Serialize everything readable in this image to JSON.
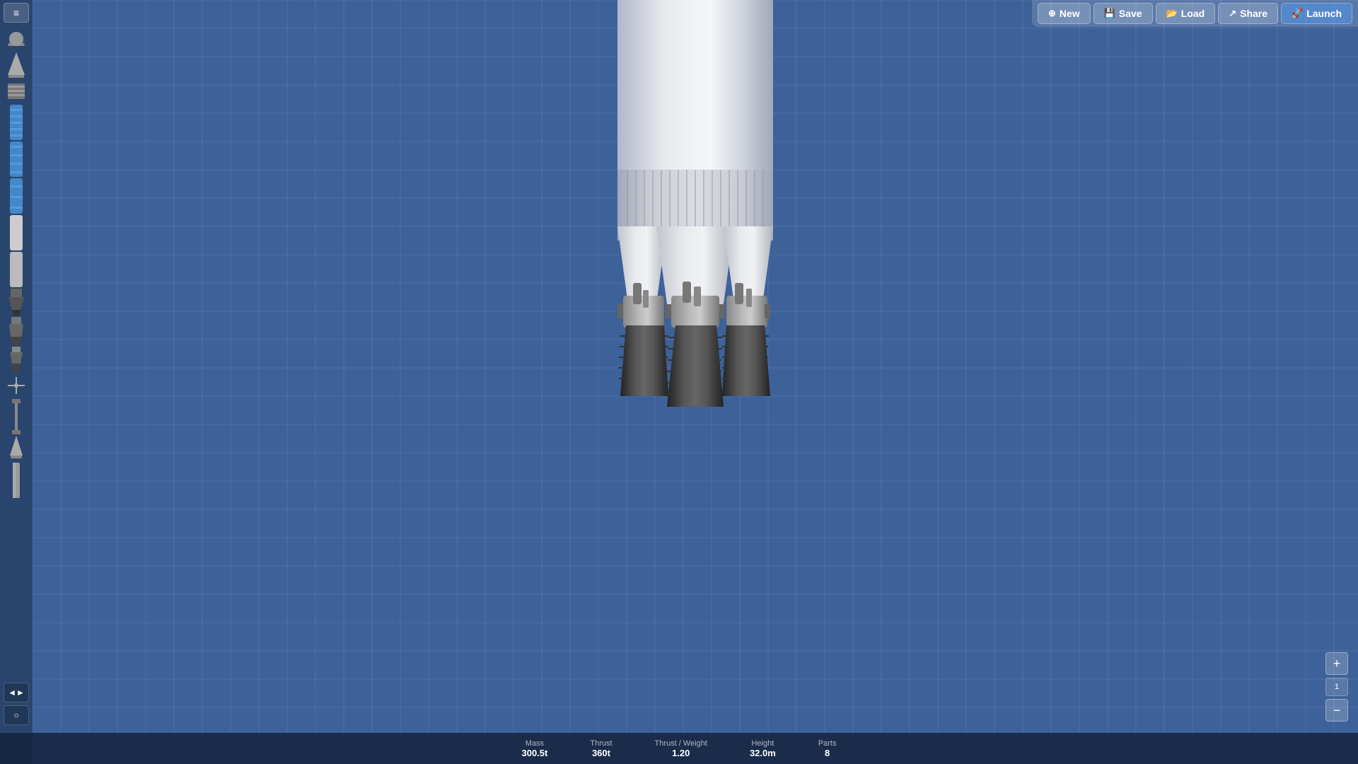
{
  "toolbar": {
    "new_label": "New",
    "save_label": "Save",
    "load_label": "Load",
    "share_label": "Share",
    "launch_label": "Launch"
  },
  "stats": {
    "mass_label": "Mass",
    "mass_value": "300.5t",
    "thrust_label": "Thrust",
    "thrust_value": "360t",
    "tw_label": "Thrust / Weight",
    "tw_value": "1.20",
    "height_label": "Height",
    "height_value": "32.0m",
    "parts_label": "Parts",
    "parts_value": "8"
  },
  "zoom": {
    "value": "1",
    "plus_label": "+",
    "minus_label": "−"
  },
  "sidebar": {
    "menu_icon": "≡",
    "parts": [
      {
        "name": "nose-cone",
        "symbol": "▲"
      },
      {
        "name": "fuel-tank-striped",
        "symbol": "▬"
      },
      {
        "name": "fuel-tank-blue1",
        "symbol": "▮"
      },
      {
        "name": "fuel-tank-blue2",
        "symbol": "▮"
      },
      {
        "name": "fuel-tank-blue3",
        "symbol": "▮"
      },
      {
        "name": "fuel-tank-white1",
        "symbol": "▮"
      },
      {
        "name": "engine1",
        "symbol": "⚙"
      },
      {
        "name": "engine2",
        "symbol": "⚙"
      },
      {
        "name": "engine3",
        "symbol": "⚙"
      },
      {
        "name": "separator",
        "symbol": "✛"
      },
      {
        "name": "strut",
        "symbol": "|"
      },
      {
        "name": "small-cone",
        "symbol": "▲"
      },
      {
        "name": "tube",
        "symbol": "▮"
      }
    ]
  },
  "bottom_left": {
    "arrows_label": "◄►",
    "circle_label": "○"
  }
}
